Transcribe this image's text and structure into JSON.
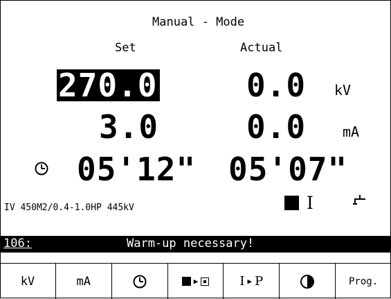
{
  "title": "Manual - Mode",
  "columns": {
    "set": "Set",
    "actual": "Actual"
  },
  "rows": {
    "kv": {
      "set": "270.0",
      "actual": "0.0",
      "unit": "kV"
    },
    "ma": {
      "set": "3.0",
      "actual": "0.0",
      "unit": "mA"
    },
    "time": {
      "set": "05'12\"",
      "actual": "05'07\""
    }
  },
  "tube_info": "IV 450M2/0.4-1.0HP 445kV",
  "indicators": {
    "shutter_label": "I",
    "icons": [
      "filled-square-indicator",
      "tap-icon"
    ]
  },
  "message": {
    "code": "106:",
    "text": "Warm-up necessary!"
  },
  "softkeys": {
    "kv": "kV",
    "ma": "mA",
    "timer": "clock-icon",
    "mode": "square-to-square-icon",
    "ip_left": "I",
    "ip_right": "P",
    "contrast": "contrast-icon",
    "prog": "Prog."
  }
}
